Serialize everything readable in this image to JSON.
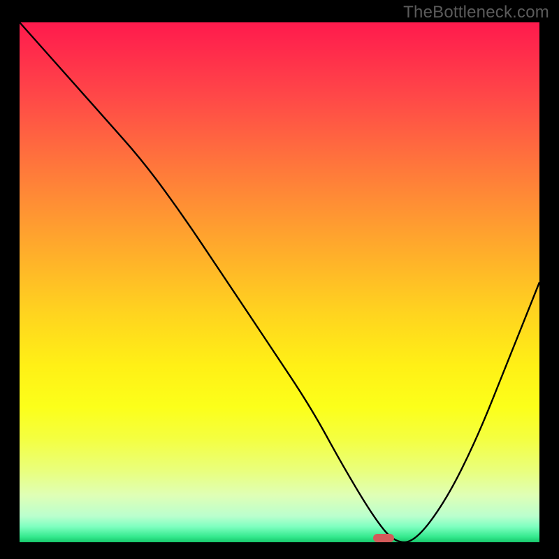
{
  "watermark": "TheBottleneck.com",
  "chart_data": {
    "type": "line",
    "title": "",
    "xlabel": "",
    "ylabel": "",
    "xlim": [
      0,
      1
    ],
    "ylim": [
      0,
      1
    ],
    "grid": false,
    "x": [
      0.0,
      0.08,
      0.16,
      0.24,
      0.32,
      0.4,
      0.48,
      0.56,
      0.62,
      0.68,
      0.72,
      0.76,
      0.82,
      0.88,
      0.94,
      1.0
    ],
    "values": [
      1.0,
      0.91,
      0.82,
      0.73,
      0.62,
      0.5,
      0.38,
      0.26,
      0.15,
      0.05,
      0.0,
      0.0,
      0.08,
      0.2,
      0.35,
      0.5
    ],
    "marker": {
      "x": 0.7,
      "y": 0.0
    }
  },
  "colors": {
    "watermark": "#5b5b5b",
    "curve": "#000000",
    "marker": "#d35a5a",
    "plot_border": "#000000"
  }
}
